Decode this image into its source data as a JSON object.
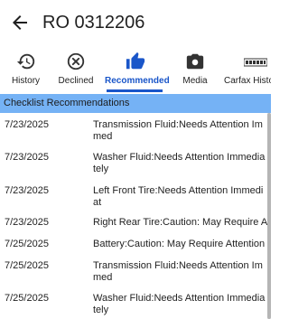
{
  "header": {
    "title": "RO 0312206"
  },
  "tabs": [
    {
      "label": "History",
      "icon": "history-icon",
      "active": false
    },
    {
      "label": "Declined",
      "icon": "declined-icon",
      "active": false
    },
    {
      "label": "Recommended",
      "icon": "thumbs-up-icon",
      "active": true
    },
    {
      "label": "Media",
      "icon": "camera-icon",
      "active": false
    },
    {
      "label": "Carfax History",
      "icon": "carfax-logo-icon",
      "active": false
    }
  ],
  "section": {
    "title": "Checklist Recommendations"
  },
  "items": [
    {
      "date": "7/23/2025",
      "text": "Transmission Fluid:Needs Attention Immed"
    },
    {
      "date": "7/23/2025",
      "text": "Washer Fluid:Needs Attention Immediately"
    },
    {
      "date": "7/23/2025",
      "text": "Left Front Tire:Needs Attention Immediat"
    },
    {
      "date": "7/23/2025",
      "text": "Right Rear Tire:Caution: May Require Att"
    },
    {
      "date": "7/25/2025",
      "text": "Battery:Caution: May Require Attention"
    },
    {
      "date": "7/25/2025",
      "text": "Transmission Fluid:Needs Attention Immed"
    },
    {
      "date": "7/25/2025",
      "text": "Washer Fluid:Needs Attention Immediately"
    }
  ],
  "colors": {
    "accent": "#1a56c9",
    "section_header": "#75b2f5"
  }
}
